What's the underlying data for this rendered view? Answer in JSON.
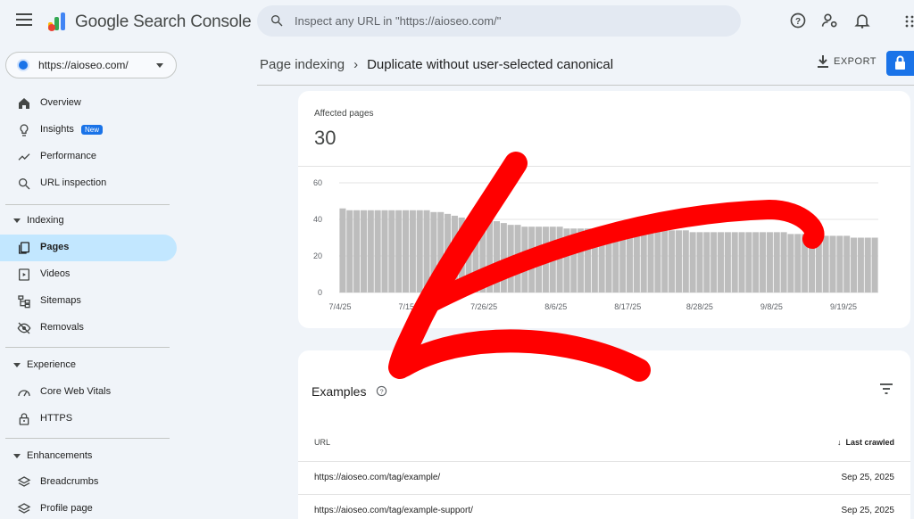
{
  "app": {
    "brand": "Google Search Console"
  },
  "search": {
    "placeholder": "Inspect any URL in \"https://aioseo.com/\""
  },
  "property": {
    "name": "https://aioseo.com/"
  },
  "sidebar": {
    "top_items": [
      {
        "label": "Overview",
        "icon": "home-icon"
      },
      {
        "label": "Insights",
        "icon": "lightbulb-icon",
        "badge": "New"
      },
      {
        "label": "Performance",
        "icon": "trending-up-icon"
      },
      {
        "label": "URL inspection",
        "icon": "search-icon"
      }
    ],
    "sections": [
      {
        "label": "Indexing",
        "items": [
          {
            "label": "Pages",
            "icon": "pages-icon",
            "active": true
          },
          {
            "label": "Videos",
            "icon": "video-icon"
          },
          {
            "label": "Sitemaps",
            "icon": "sitemap-icon"
          },
          {
            "label": "Removals",
            "icon": "eye-off-icon"
          }
        ]
      },
      {
        "label": "Experience",
        "items": [
          {
            "label": "Core Web Vitals",
            "icon": "speedometer-icon"
          },
          {
            "label": "HTTPS",
            "icon": "lock-icon"
          }
        ]
      },
      {
        "label": "Enhancements",
        "items": [
          {
            "label": "Breadcrumbs",
            "icon": "layers-icon"
          },
          {
            "label": "Profile page",
            "icon": "layers-icon"
          }
        ]
      }
    ]
  },
  "breadcrumb": {
    "parent": "Page indexing",
    "separator": "›",
    "current": "Duplicate without user-selected canonical"
  },
  "toolbar": {
    "export_label": "EXPORT"
  },
  "summary": {
    "caption": "Affected pages",
    "value": "30"
  },
  "chart_data": {
    "type": "bar",
    "ylim": [
      0,
      60
    ],
    "yticks": [
      "0",
      "20",
      "40",
      "60"
    ],
    "xtick_labels": [
      "7/4/25",
      "7/15/25",
      "7/26/25",
      "8/6/25",
      "8/17/25",
      "8/28/25",
      "9/8/25",
      "9/19/25"
    ],
    "bar_color": "#bdbdbd",
    "grid": true,
    "values": [
      46,
      45,
      45,
      45,
      45,
      45,
      45,
      45,
      45,
      45,
      45,
      45,
      45,
      44,
      44,
      43,
      42,
      41,
      40,
      40,
      40,
      40,
      39,
      38,
      37,
      37,
      36,
      36,
      36,
      36,
      36,
      36,
      35,
      35,
      35,
      35,
      35,
      35,
      35,
      35,
      35,
      35,
      35,
      35,
      35,
      35,
      34,
      34,
      34,
      34,
      33,
      33,
      33,
      33,
      33,
      33,
      33,
      33,
      33,
      33,
      33,
      33,
      33,
      33,
      32,
      32,
      32,
      32,
      31,
      31,
      31,
      31,
      31,
      30,
      30,
      30,
      30
    ]
  },
  "examples": {
    "title": "Examples",
    "col_url": "URL",
    "col_last_crawled": "Last crawled",
    "sort_arrow": "↓",
    "rows": [
      {
        "url": "https://aioseo.com/tag/example/",
        "date": "Sep 25, 2025"
      },
      {
        "url": "https://aioseo.com/tag/example-support/",
        "date": "Sep 25, 2025"
      }
    ]
  }
}
